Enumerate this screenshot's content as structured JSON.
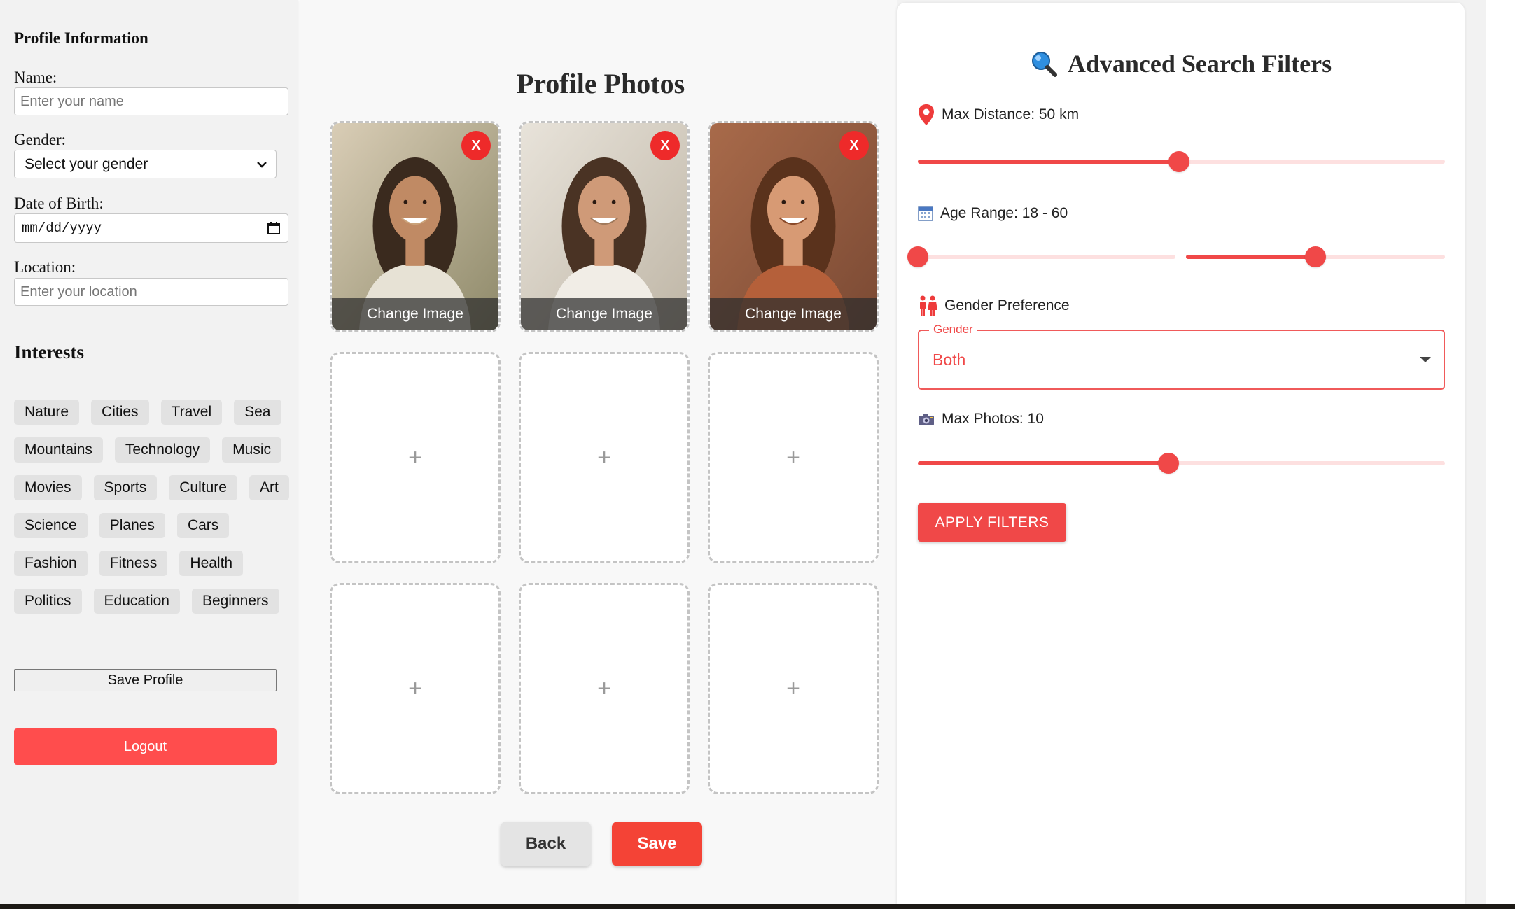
{
  "profile": {
    "section_title": "Profile Information",
    "name_label": "Name:",
    "name_placeholder": "Enter your name",
    "gender_label": "Gender:",
    "gender_selected": "Select your gender",
    "dob_label": "Date of Birth:",
    "dob_placeholder": "mm/dd/yyyy",
    "location_label": "Location:",
    "location_placeholder": "Enter your location",
    "interests_title": "Interests",
    "interests": [
      "Nature",
      "Cities",
      "Travel",
      "Sea",
      "Mountains",
      "Technology",
      "Music",
      "Movies",
      "Sports",
      "Culture",
      "Art",
      "Science",
      "Planes",
      "Cars",
      "Fashion",
      "Fitness",
      "Health",
      "Politics",
      "Education",
      "Beginners"
    ],
    "save_label": "Save Profile",
    "logout_label": "Logout"
  },
  "photos": {
    "title": "Profile Photos",
    "slots": [
      {
        "filled": true,
        "change_label": "Change Image",
        "remove_label": "X"
      },
      {
        "filled": true,
        "change_label": "Change Image",
        "remove_label": "X"
      },
      {
        "filled": true,
        "change_label": "Change Image",
        "remove_label": "X"
      },
      {
        "filled": false,
        "add_label": "+"
      },
      {
        "filled": false,
        "add_label": "+"
      },
      {
        "filled": false,
        "add_label": "+"
      },
      {
        "filled": false,
        "add_label": "+"
      },
      {
        "filled": false,
        "add_label": "+"
      },
      {
        "filled": false,
        "add_label": "+"
      }
    ],
    "back_label": "Back",
    "save_label": "Save"
  },
  "filters": {
    "title": "Advanced Search Filters",
    "title_icon": "magnifier-icon",
    "distance": {
      "label": "Max Distance: 50 km",
      "icon": "map-pin-icon",
      "value": 50,
      "fraction": 0.495
    },
    "age": {
      "label": "Age Range: 18 - 60",
      "icon": "calendar-icon",
      "min": 18,
      "max": 60,
      "min_fraction": 0.0,
      "max_fraction": 0.5
    },
    "gender_pref": {
      "label": "Gender Preference",
      "icon": "couple-icon",
      "field_label": "Gender",
      "value": "Both"
    },
    "photos": {
      "label": "Max Photos: 10",
      "icon": "camera-icon",
      "value": 10,
      "fraction": 0.475
    },
    "apply_label": "APPLY FILTERS"
  },
  "colors": {
    "accent": "#f04848",
    "logout": "#ff4d4d",
    "save": "#f44336"
  }
}
